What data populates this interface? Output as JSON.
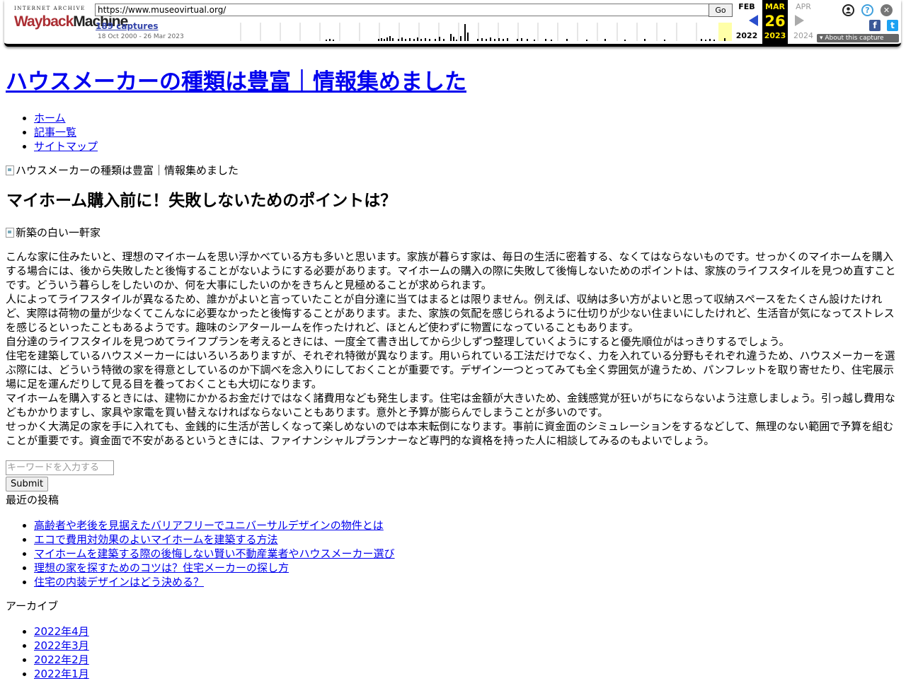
{
  "wayback": {
    "logo_top": "INTERNET ARCHIVE",
    "logo_w1": "Wayback",
    "logo_w2": "Machine",
    "url": "https://www.museovirtual.org/",
    "go_label": "Go",
    "captures": "189 captures",
    "range": "18 Oct 2000 - 26 Mar 2023",
    "prev": {
      "month": "FEB",
      "year": "2022"
    },
    "cur": {
      "month": "MAR",
      "day": "26",
      "year": "2023"
    },
    "next": {
      "month": "APR",
      "year": "2024"
    },
    "about": "About this capture"
  },
  "site": {
    "title": "ハウスメーカーの種類は豊富｜情報集めました",
    "nav": [
      "ホーム",
      "記事一覧",
      "サイトマップ"
    ],
    "header_img_alt": "ハウスメーカーの種類は豊富｜情報集めました"
  },
  "post": {
    "title": "マイホーム購入前に！失敗しないためのポイントは？",
    "img_alt": "新築の白い一軒家",
    "paragraphs": [
      "こんな家に住みたいと、理想のマイホームを思い浮かべている方も多いと思います。家族が暮らす家は、毎日の生活に密着する、なくてはならないものです。せっかくのマイホームを購入する場合には、後から失敗したと後悔することがないようにする必要があります。マイホームの購入の際に失敗して後悔しないためのポイントは、家族のライフスタイルを見つめ直すことです。どういう暮らしをしたいのか、何を大事にしたいのかをきちんと見極めることが求められます。",
      "人によってライフスタイルが異なるため、誰かがよいと言っていたことが自分達に当てはまるとは限りません。例えば、収納は多い方がよいと思って収納スペースをたくさん設けたけれど、実際は荷物の量が少なくてこんなに必要なかったと後悔することがあります。また、家族の気配を感じられるように仕切りが少ない住まいにしたけれど、生活音が気になってストレスを感じるといったこともあるようです。趣味のシアタールームを作ったけれど、ほとんど使わずに物置になっていることもあります。",
      "自分達のライフスタイルを見つめてライフプランを考えるときには、一度全て書き出してから少しずつ整理していくようにすると優先順位がはっきりするでしょう。",
      "住宅を建築しているハウスメーカーにはいろいろありますが、それぞれ特徴が異なります。用いられている工法だけでなく、力を入れている分野もそれぞれ違うため、ハウスメーカーを選ぶ際には、どういう特徴の家を得意としているのか下調べを念入りにしておくことが重要です。デザイン一つとってみても全く雰囲気が違うため、パンフレットを取り寄せたり、住宅展示場に足を運んだりして見る目を養っておくことも大切になります。",
      "マイホームを購入するときには、建物にかかるお金だけではなく諸費用なども発生します。住宅は金額が大きいため、金銭感覚が狂いがちにならないよう注意しましょう。引っ越し費用などもかかりますし、家具や家電を買い替えなければならないこともあります。意外と予算が膨らんでしまうことが多いのです。",
      "せっかく大満足の家を手に入れても、金銭的に生活が苦しくなって楽しめないのでは本末転倒になります。事前に資金面のシミュレーションをするなどして、無理のない範囲で予算を組むことが重要です。資金面で不安があるというときには、ファイナンシャルプランナーなど専門的な資格を持った人に相談してみるのもよいでしょう。"
    ]
  },
  "sidebar": {
    "search_placeholder": "キーワードを入力する",
    "submit": "Submit",
    "recent_title": "最近の投稿",
    "recent": [
      "高齢者や老後を見据えたバリアフリーでユニバーサルデザインの物件とは",
      "エコで費用対効果のよいマイホームを建築する方法",
      "マイホームを建築する際の後悔しない賢い不動産業者やハウスメーカー選び",
      "理想の家を探すためのコツは？住宅メーカーの探し方",
      "住宅の内装デザインはどう決める？"
    ],
    "archive_title": "アーカイブ",
    "archives": [
      "2022年4月",
      "2022年3月",
      "2022年2月",
      "2022年1月"
    ]
  }
}
